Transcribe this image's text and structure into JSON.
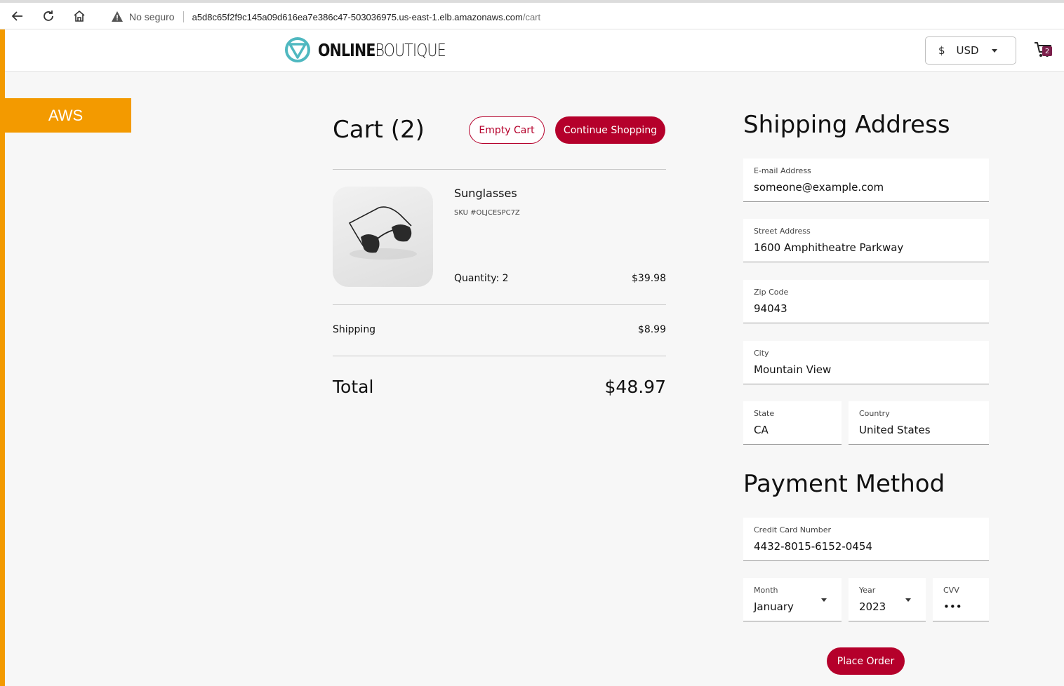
{
  "browser": {
    "security_label": "No seguro",
    "url_host": "a5d8c65f2f9c145a09d616ea7e386c47-503036975.us-east-1.elb.amazonaws.com",
    "url_path": "/cart"
  },
  "banner": {
    "label": "AWS",
    "color": "#f39a00"
  },
  "header": {
    "logo_bold": "ONLINE",
    "logo_thin": "BOUTIQUE",
    "currency_symbol": "$",
    "currency_code": "USD",
    "cart_count": "2"
  },
  "cart": {
    "title": "Cart (2)",
    "empty_button": "Empty Cart",
    "continue_button": "Continue Shopping",
    "item": {
      "name": "Sunglasses",
      "sku": "SKU #OLJCESPC7Z",
      "quantity": "Quantity: 2",
      "price": "$39.98"
    },
    "shipping_label": "Shipping",
    "shipping_value": "$8.99",
    "total_label": "Total",
    "total_value": "$48.97"
  },
  "shipping_address": {
    "title": "Shipping Address",
    "email": {
      "label": "E-mail Address",
      "value": "someone@example.com"
    },
    "street": {
      "label": "Street Address",
      "value": "1600 Amphitheatre Parkway"
    },
    "zip": {
      "label": "Zip Code",
      "value": "94043"
    },
    "city": {
      "label": "City",
      "value": "Mountain View"
    },
    "state": {
      "label": "State",
      "value": "CA"
    },
    "country": {
      "label": "Country",
      "value": "United States"
    }
  },
  "payment": {
    "title": "Payment Method",
    "card": {
      "label": "Credit Card Number",
      "value": "4432-8015-6152-0454"
    },
    "month": {
      "label": "Month",
      "value": "January"
    },
    "year": {
      "label": "Year",
      "value": "2023"
    },
    "cvv": {
      "label": "CVV",
      "value": "•••"
    },
    "place_order": "Place Order"
  },
  "colors": {
    "accent": "#b5002b",
    "aws": "#f39a00",
    "logo_teal": "#4fb8c0"
  }
}
